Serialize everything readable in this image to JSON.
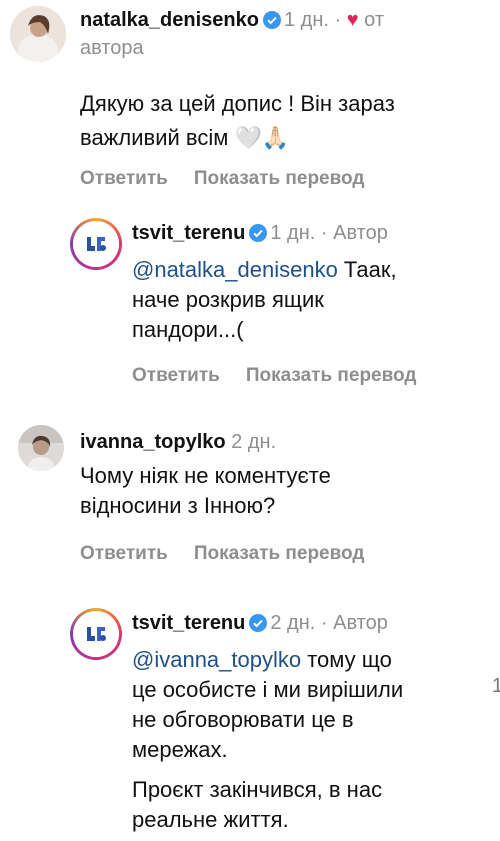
{
  "comments": [
    {
      "username": "natalka_denisenko",
      "time": "1 дн.",
      "separator": "·",
      "heart": "♥",
      "author_note_line1": "от",
      "author_note_line2": "автора",
      "text_line1": "Дякую за цей допис ! Він зараз",
      "text_line2": "важливий всім 🤍🙏🏻",
      "reply": "Ответить",
      "translate": "Показать перевод"
    },
    {
      "username": "tsvit_terenu",
      "time": "1 дн.",
      "separator": "·",
      "author_label": "Автор",
      "mention": "@natalka_denisenko",
      "text_line1_rest": " Таак,",
      "text_line2": "наче розкрив ящик",
      "text_line3": "пандори...(",
      "reply": "Ответить",
      "translate": "Показать перевод"
    },
    {
      "username": "ivanna_topylko",
      "time": "2 дн.",
      "text_line1": "Чому ніяк не коментуєте",
      "text_line2": "відносини з Інною?",
      "reply": "Ответить",
      "translate": "Показать перевод"
    },
    {
      "username": "tsvit_terenu",
      "time": "2 дн.",
      "separator": "·",
      "author_label": "Автор",
      "mention": "@ivanna_topylko",
      "text_line1_rest": " тому що",
      "text_line2": "це особисте і ми вирішили",
      "text_line3": "не обговорювати це в",
      "text_line4": "мережах.",
      "text_line5": "Проєкт закінчився, в нас",
      "text_line6": "реальне життя."
    }
  ],
  "edge_number": "1",
  "colors": {
    "verified": "#3897f0",
    "heart": "#e0245e",
    "mention": "#1f4f8a",
    "meta": "#8e8e8e"
  }
}
